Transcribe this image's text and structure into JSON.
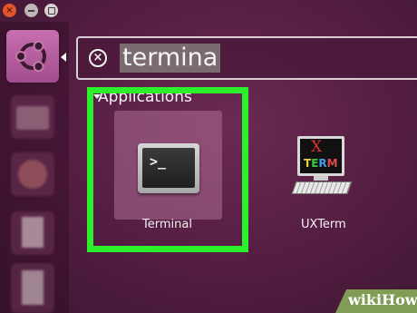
{
  "window_controls": {
    "close_glyph": "×"
  },
  "launcher": {
    "items": [
      {
        "name": "dash-home",
        "icon": "ubuntu-logo-icon"
      },
      {
        "name": "files",
        "icon": "folder-icon"
      },
      {
        "name": "firefox",
        "icon": "firefox-icon"
      },
      {
        "name": "writer",
        "icon": "document-icon"
      },
      {
        "name": "writer2",
        "icon": "document-icon"
      }
    ]
  },
  "search": {
    "clear_glyph": "×",
    "query": "termina"
  },
  "applications": {
    "section_title": "Applications",
    "items": [
      {
        "label": "Terminal",
        "icon": "terminal-icon",
        "prompt": ">_"
      },
      {
        "label": "UXTerm",
        "icon": "uxterm-icon",
        "x_letter": "X",
        "term_letters": [
          "T",
          "E",
          "R",
          "M"
        ]
      }
    ]
  },
  "colors": {
    "highlight": "#2bf02b",
    "background": "#571f44",
    "dash_button": "#b05e9d"
  },
  "watermark": {
    "text": "wikiHow"
  }
}
